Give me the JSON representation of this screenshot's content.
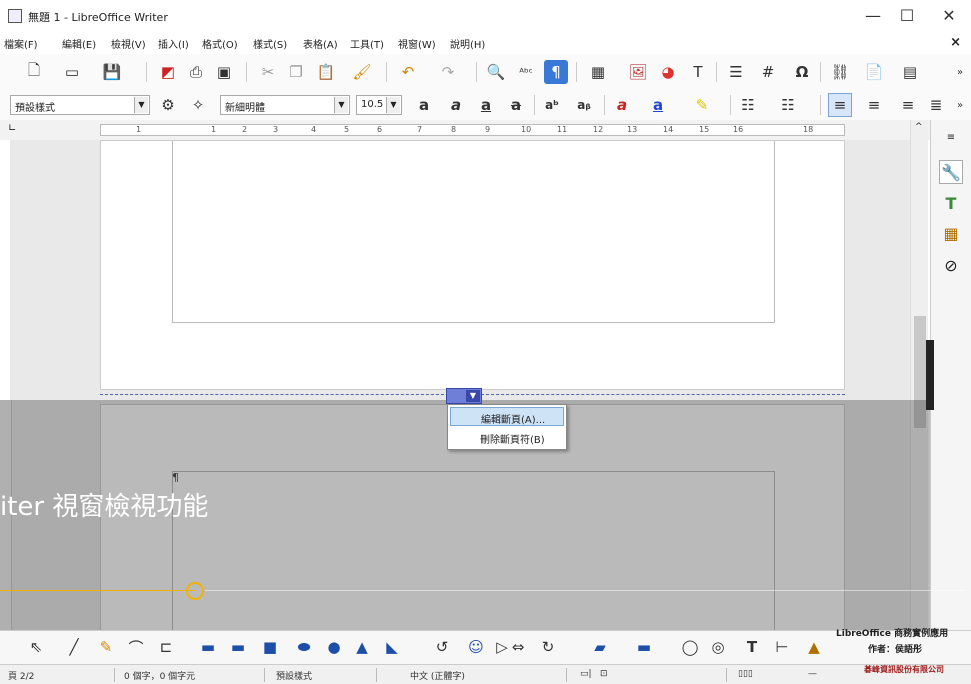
{
  "window": {
    "title": "無題 1 - LibreOffice Writer",
    "minimize": "—",
    "maximize": "☐",
    "close": "✕"
  },
  "menubar": {
    "items": [
      "檔案(F)",
      "編輯(E)",
      "檢視(V)",
      "插入(I)",
      "格式(O)",
      "樣式(S)",
      "表格(A)",
      "工具(T)",
      "視窗(W)",
      "說明(H)"
    ],
    "close": "×"
  },
  "formatting": {
    "paragraph_style": "預設樣式",
    "font_name": "新細明體",
    "font_size": "10.5"
  },
  "ruler": {
    "numbers": [
      "1",
      "1",
      "2",
      "3",
      "4",
      "5",
      "6",
      "7",
      "8",
      "9",
      "10",
      "11",
      "12",
      "13",
      "14",
      "15",
      "16",
      "18"
    ]
  },
  "page2": {
    "pilcrow": "¶"
  },
  "context_menu": {
    "items": [
      "編輯斷頁(A)...",
      "刪除斷頁符(B)"
    ]
  },
  "overlay": {
    "title": "iter 視窗檢視功能"
  },
  "statusbar": {
    "page": "頁 2/2",
    "words": "0 個字，0 個字元",
    "style": "預設樣式",
    "language": "中文 (正體字)"
  },
  "watermark": {
    "line1": "LibreOffice 商務實例應用",
    "line2": "作者：侯語彤",
    "line3": "碁峰資訊股份有限公司"
  },
  "accent_colors": {
    "page_break": "#6f7fd8",
    "overlay_line": "#f0b400",
    "highlight": "#cfe3f7"
  }
}
